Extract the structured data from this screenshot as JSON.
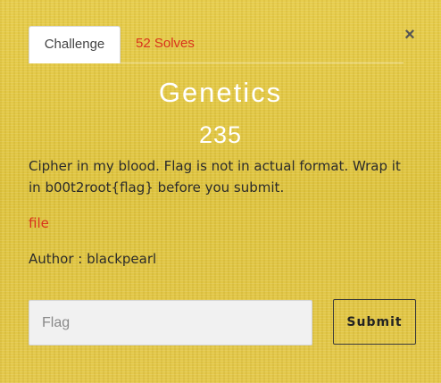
{
  "tabs": {
    "challenge_label": "Challenge",
    "solves_label": "52 Solves"
  },
  "close_label": "×",
  "challenge": {
    "title": "Genetics",
    "points": "235",
    "description": "Cipher in my blood. Flag is not in actual format. Wrap it in b00t2root{flag} before you submit.",
    "file_link": "file",
    "author": "Author : blackpearl"
  },
  "form": {
    "flag_placeholder": "Flag",
    "flag_value": "",
    "submit_label": "Submit"
  },
  "colors": {
    "accent": "#d9331c",
    "background": "#e0c440",
    "title": "#ffffff"
  }
}
